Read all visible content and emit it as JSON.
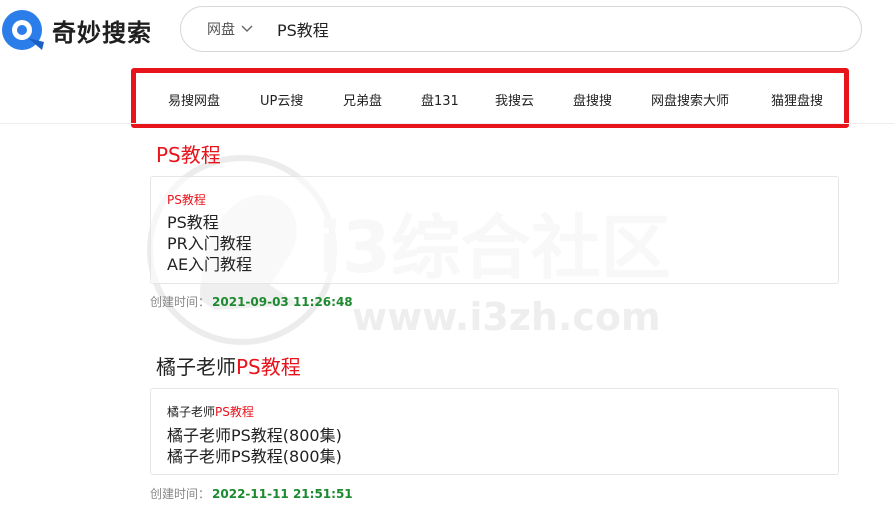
{
  "brand": {
    "name": "奇妙搜索",
    "accent": "#1a73e8"
  },
  "search": {
    "scope": "网盘",
    "query": "PS教程",
    "chevron_icon": "chevron-down-icon"
  },
  "engines": [
    "易搜网盘",
    "UP云搜",
    "兄弟盘",
    "盘131",
    "我搜云",
    "盘搜搜",
    "网盘搜索大师",
    "猫狸盘搜"
  ],
  "watermark": {
    "main": "i3综合社区",
    "url": "www.i3zh.com"
  },
  "colors": {
    "highlight": "#e8141c",
    "time": "#1c8a2e",
    "frame": "#e8141c"
  },
  "results": [
    {
      "title_pre": "",
      "title_hl": "PS教程",
      "head_pre": "",
      "head_hl": "PS教程",
      "lines": [
        "PS教程",
        "PR入门教程",
        "AE入门教程"
      ],
      "created_label": "创建时间：",
      "created_time": "2021-09-03 11:26:48"
    },
    {
      "title_pre": "橘子老师",
      "title_hl": "PS教程",
      "head_pre": "橘子老师",
      "head_hl": "PS教程",
      "lines": [
        "橘子老师PS教程(800集)",
        "橘子老师PS教程(800集)"
      ],
      "created_label": "创建时间：",
      "created_time": "2022-11-11 21:51:51"
    }
  ]
}
